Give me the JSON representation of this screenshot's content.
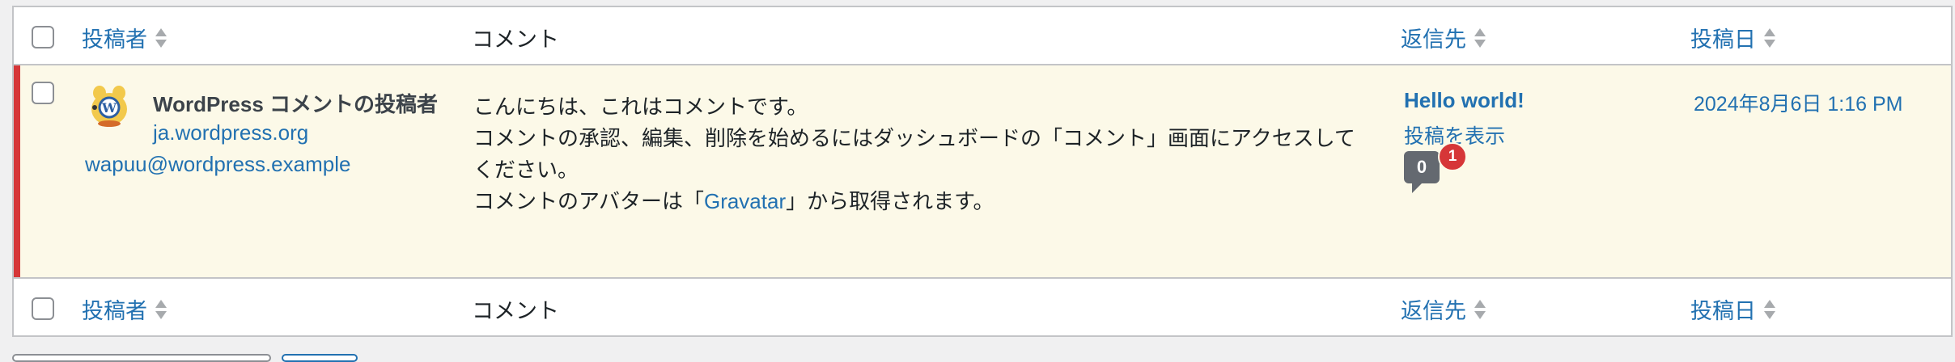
{
  "columns": {
    "author": "投稿者",
    "comment": "コメント",
    "response": "返信先",
    "date": "投稿日"
  },
  "row": {
    "author_name": "WordPress コメントの投稿者",
    "author_url": "ja.wordpress.org",
    "author_email": "wapuu@wordpress.example",
    "comment_line1": "こんにちは、これはコメントです。",
    "comment_line2": "コメントの承認、編集、削除を始めるにはダッシュボードの「コメント」画面にアクセスしてください。",
    "comment_line3_pre": "コメントのアバターは「",
    "comment_link": "Gravatar",
    "comment_line3_post": "」から取得されます。",
    "response_title": "Hello world!",
    "response_view": "投稿を表示",
    "approved_count": "0",
    "pending_count": "1",
    "date": "2024年8月6日 1:16 PM"
  },
  "colors": {
    "link": "#2271b1",
    "unapproved_bar": "#d63638",
    "unapproved_bg": "#fcf9e8"
  },
  "icons": {
    "sort": "sort-icon",
    "avatar": "wapuu-avatar",
    "comment_bubble": "comment-bubble-icon"
  }
}
